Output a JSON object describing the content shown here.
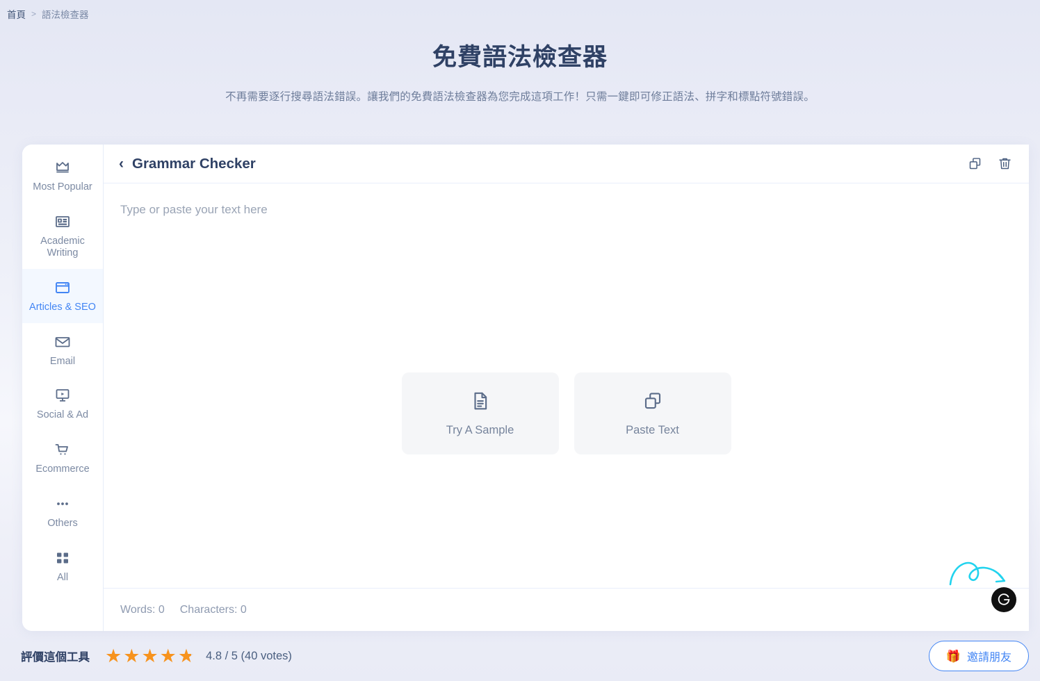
{
  "breadcrumb": {
    "home": "首頁",
    "separator": ">",
    "current": "語法檢查器"
  },
  "hero": {
    "title": "免費語法檢查器",
    "subtitle": "不再需要逐行搜尋語法錯誤。讓我們的免費語法檢查器為您完成這項工作！只需一鍵即可修正語法、拼字和標點符號錯誤。"
  },
  "sidebar": {
    "items": [
      {
        "label": "Most Popular",
        "icon": "crown-icon",
        "active": false
      },
      {
        "label": "Academic Writing",
        "icon": "id-card-icon",
        "active": false
      },
      {
        "label": "Articles & SEO",
        "icon": "browser-window-icon",
        "active": true
      },
      {
        "label": "Email",
        "icon": "envelope-icon",
        "active": false
      },
      {
        "label": "Social & Ad",
        "icon": "monitor-play-icon",
        "active": false
      },
      {
        "label": "Ecommerce",
        "icon": "shopping-cart-icon",
        "active": false
      },
      {
        "label": "Others",
        "icon": "ellipsis-icon",
        "active": false
      },
      {
        "label": "All",
        "icon": "grid-icon",
        "active": false
      }
    ]
  },
  "panel": {
    "back_icon": "chevron-left-icon",
    "title": "Grammar Checker",
    "copy_icon": "copy-icon",
    "delete_icon": "trash-icon"
  },
  "editor": {
    "placeholder": "Type or paste your text here",
    "value": "",
    "cta": [
      {
        "label": "Try A Sample",
        "icon": "document-icon"
      },
      {
        "label": "Paste Text",
        "icon": "copy-icon"
      }
    ]
  },
  "status": {
    "words": "Words: 0",
    "characters": "Characters: 0",
    "assistant_badge": "G"
  },
  "rating": {
    "label": "評價這個工具",
    "stars_total": 5,
    "stars_filled": 4,
    "partial_fraction": 0.8,
    "score_text": "4.8 / 5 (40 votes)"
  },
  "invite": {
    "icon": "gift-icon",
    "emoji": "🎁",
    "label": "邀請朋友"
  },
  "colors": {
    "accent": "#4285f4",
    "title": "#2f4165",
    "muted": "#7c8aa3",
    "star": "#f7931e",
    "arrow": "#22d3ee",
    "card_bg": "#ffffff",
    "cta_bg": "#f5f6f8"
  }
}
